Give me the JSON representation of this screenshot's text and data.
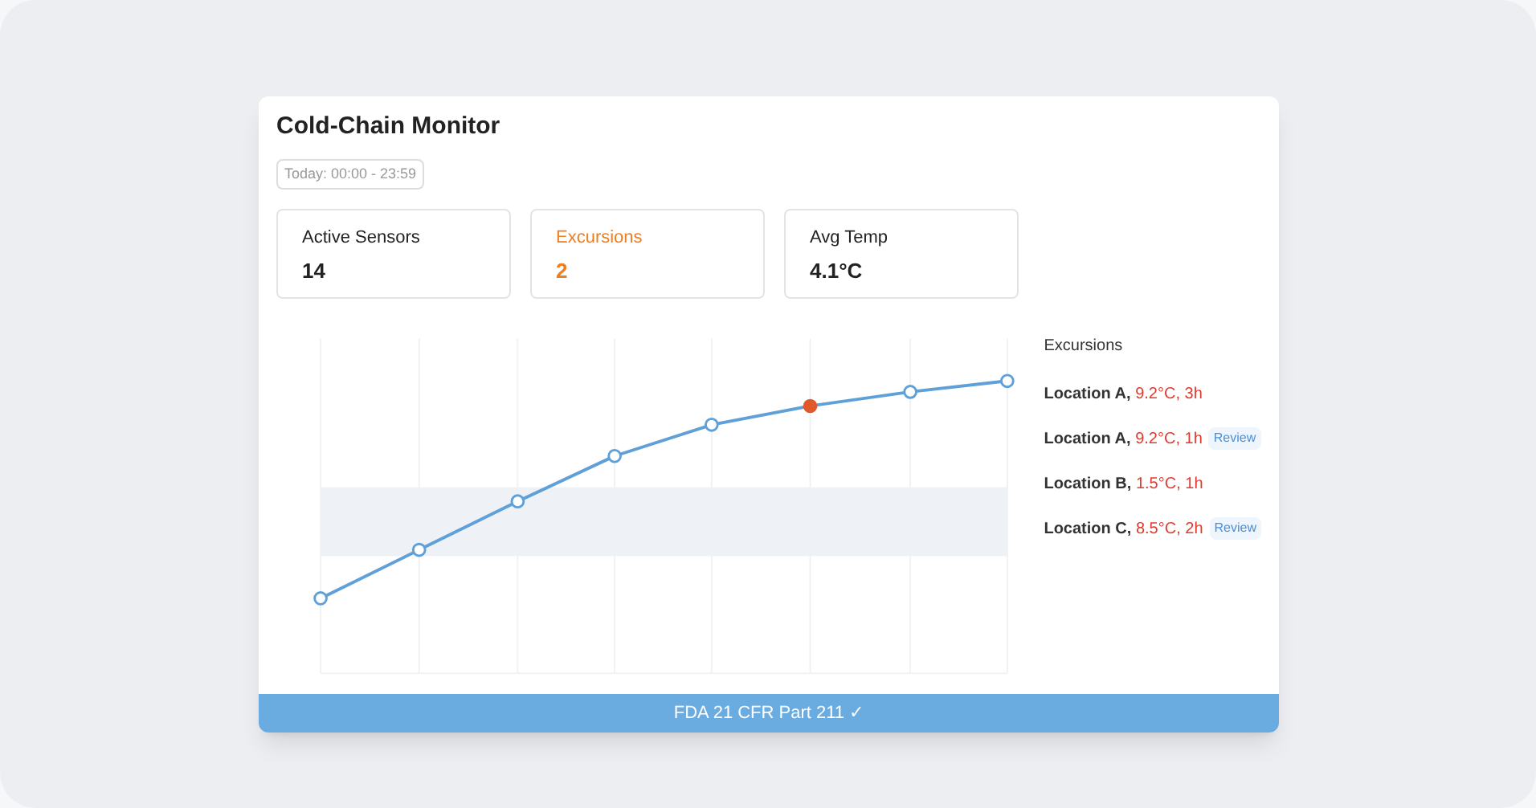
{
  "title": "Cold-Chain Monitor",
  "date_range": "Today: 00:00 - 23:59",
  "stats": [
    {
      "label": "Active Sensors",
      "value": "14",
      "highlight": false
    },
    {
      "label": "Excursions",
      "value": "2",
      "highlight": true
    },
    {
      "label": "Avg Temp",
      "value": "4.1°C",
      "highlight": false
    }
  ],
  "excursions": {
    "heading": "Excursions",
    "items": [
      {
        "location": "Location A,",
        "detail": "9.2°C, 3h"
      },
      {
        "location": "Location A,",
        "detail": "9.2°C, 1h",
        "badge": "Review"
      },
      {
        "location": "Location B,",
        "detail": "1.5°C, 1h"
      },
      {
        "location": "Location C,",
        "detail": "8.5°C, 2h",
        "badge": "Review"
      }
    ]
  },
  "footer": "FDA 21 CFR Part 211 ✓"
}
